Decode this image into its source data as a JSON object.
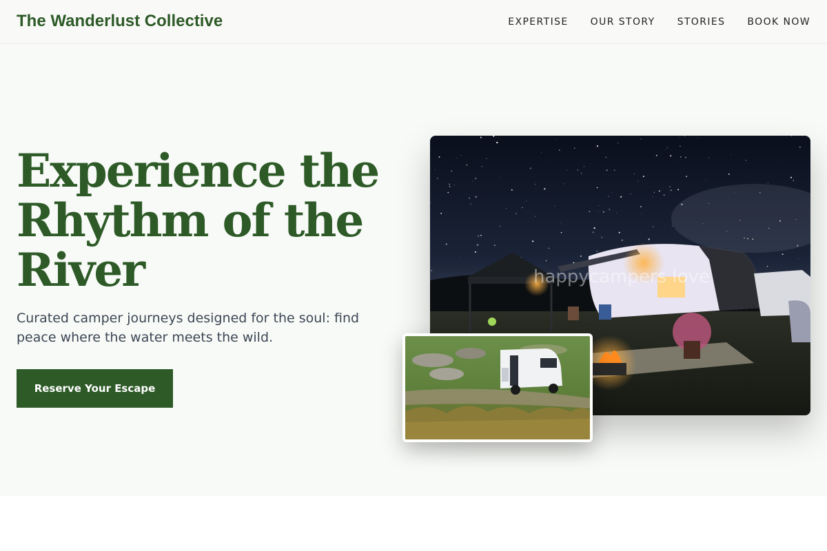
{
  "header": {
    "brand": "The Wanderlust Collective",
    "nav": [
      "EXPERTISE",
      "OUR STORY",
      "STORIES",
      "BOOK NOW"
    ]
  },
  "hero": {
    "headline": "Experience the Rhythm of the River",
    "subhead": "Curated camper journeys designed for the soul: find peace where the water meets the wild.",
    "cta": "Reserve Your Escape"
  },
  "images": {
    "main_watermark": "happycampers love",
    "main_alt": "Camper trailer at night under a starry sky with campfire",
    "small_alt": "White camper van parked in a grassy rocky landscape"
  },
  "colors": {
    "brand_green": "#2d5a27",
    "hero_background": "#f8faf7",
    "body_text": "#3c4654"
  }
}
